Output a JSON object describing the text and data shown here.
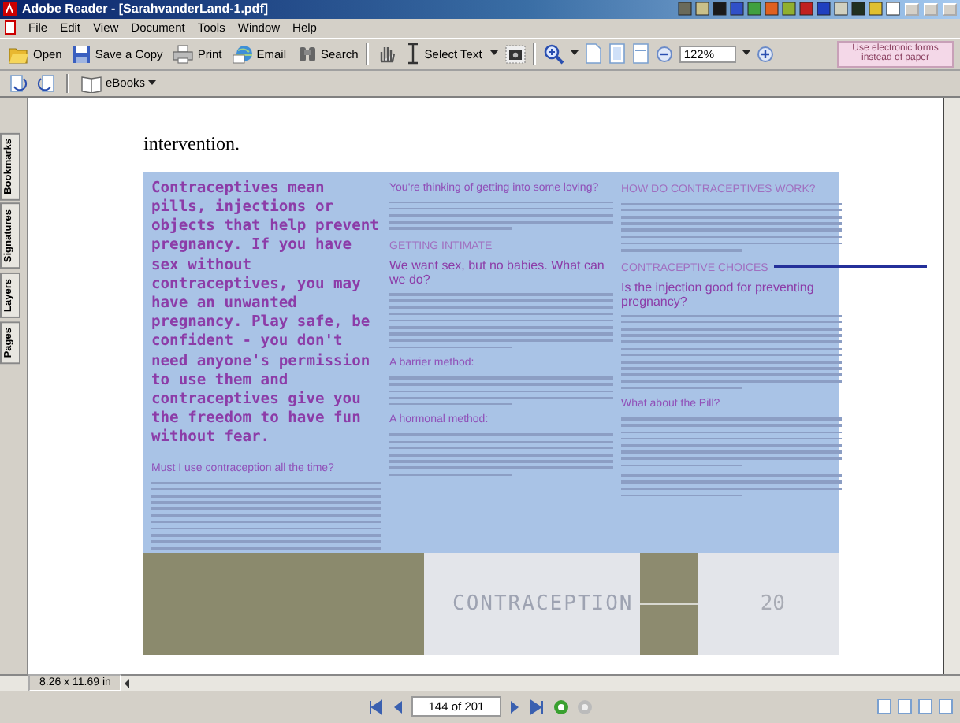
{
  "window": {
    "title": "Adobe Reader - [SarahvanderLand-1.pdf]"
  },
  "menu": [
    "File",
    "Edit",
    "View",
    "Document",
    "Tools",
    "Window",
    "Help"
  ],
  "toolbar": {
    "buttons": [
      "Open",
      "Save a Copy",
      "Print",
      "Email",
      "Search"
    ],
    "select_tool": "Select Text",
    "zoom": "122%",
    "promo": "Use electronic forms instead of paper"
  },
  "toolbar2": {
    "ebooks": "eBooks"
  },
  "side_tabs": [
    "Bookmarks",
    "Signatures",
    "Layers",
    "Pages"
  ],
  "document": {
    "text": "intervention.",
    "leaflet": {
      "columns": [
        {
          "blocks": [
            {
              "kind": "lead",
              "text": "Contraceptives mean pills, injections or objects that help prevent pregnancy. If you have sex without contraceptives, you may have an unwanted pregnancy. Play safe, be confident - you don't need anyone's permission to use them and contraceptives give you the freedom to have fun without fear."
            },
            {
              "kind": "heading",
              "text": "Must I use contraception all the time?"
            },
            {
              "kind": "body"
            }
          ]
        },
        {
          "blocks": [
            {
              "kind": "heading",
              "text": "You're thinking of getting into some loving?"
            },
            {
              "kind": "body"
            },
            {
              "kind": "caps",
              "text": "GETTING INTIMATE"
            },
            {
              "kind": "subhead",
              "text": "We want sex, but no babies. What can we do?"
            },
            {
              "kind": "body"
            },
            {
              "kind": "heading",
              "text": "A barrier method:"
            },
            {
              "kind": "body"
            },
            {
              "kind": "heading",
              "text": "A hormonal method:"
            },
            {
              "kind": "body"
            }
          ]
        },
        {
          "blocks": [
            {
              "kind": "caps",
              "text": "HOW DO CONTRACEPTIVES WORK?"
            },
            {
              "kind": "body"
            },
            {
              "kind": "caps",
              "text": "CONTRACEPTIVE CHOICES"
            },
            {
              "kind": "subhead",
              "text": "Is the injection good for preventing pregnancy?"
            },
            {
              "kind": "body"
            },
            {
              "kind": "heading",
              "text": "What about the Pill?"
            },
            {
              "kind": "body"
            },
            {
              "kind": "body"
            }
          ]
        }
      ],
      "footer": {
        "title": "CONTRACEPTION",
        "page": "20"
      }
    }
  },
  "status": {
    "page_size": "8.26 x 11.69 in",
    "page": "144 of 201"
  }
}
